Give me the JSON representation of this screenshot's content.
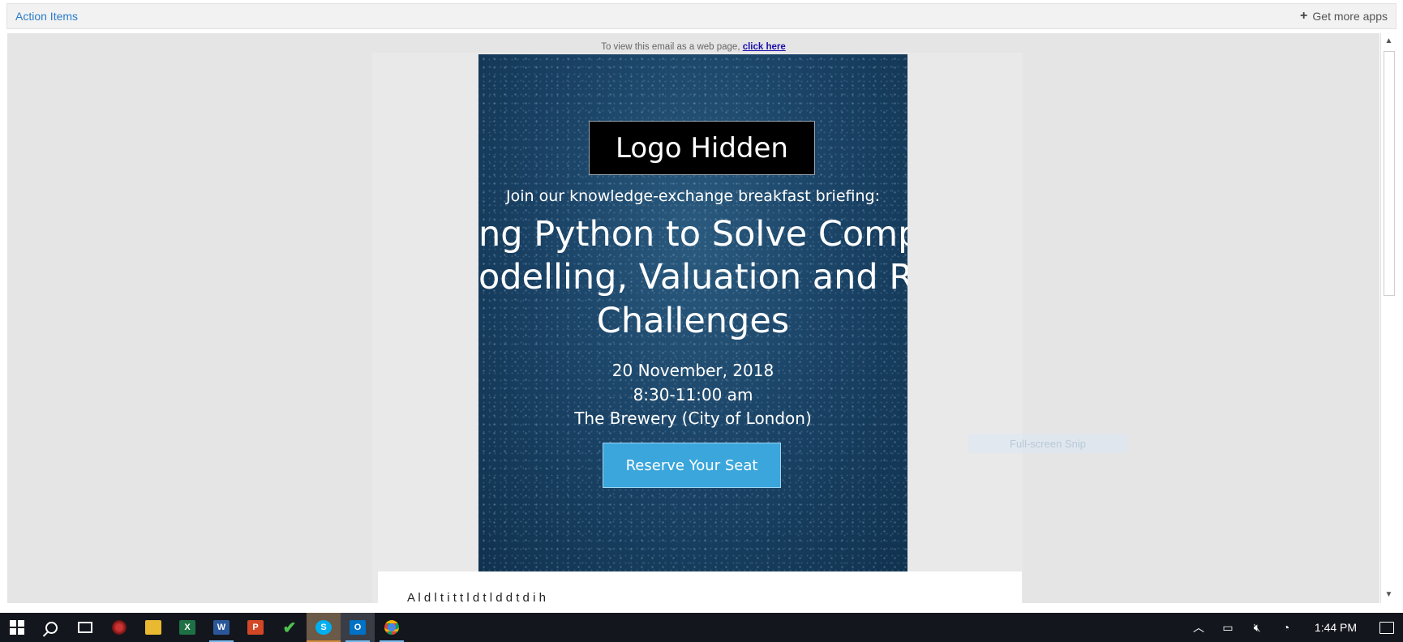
{
  "topbar": {
    "title": "Action Items",
    "get_more_label": "Get more apps"
  },
  "email": {
    "webview_text": "To view this email as a web page,",
    "webview_link": "click here",
    "logo_text": "Logo Hidden",
    "intro": "Join our knowledge-exchange breakfast briefing:",
    "headline_line1": "ng Python to Solve Comp",
    "headline_line2": "odelling, Valuation and Ri",
    "headline_line3": "Challenges",
    "date": "20 November, 2018",
    "time": "8:30-11:00 am",
    "venue": "The Brewery (City of London)",
    "cta": "Reserve Your Seat",
    "body_snippet": "A  l  d  l  t  i  t  t  l  d  t  l  d  d  t  d  i  h"
  },
  "overlay": {
    "snip_hint": "Full-screen Snip"
  },
  "taskbar": {
    "apps": [
      "windows-start",
      "search",
      "task-view",
      "app-red",
      "file-explorer",
      "excel",
      "word",
      "powerpoint",
      "tasks",
      "skype",
      "outlook",
      "chrome"
    ],
    "clock": "1:44 PM"
  },
  "colors": {
    "accent": "#2b7cc9",
    "hero_bg": "#1b4467",
    "cta": "#3aa6dc",
    "taskbar": "#14161d"
  }
}
